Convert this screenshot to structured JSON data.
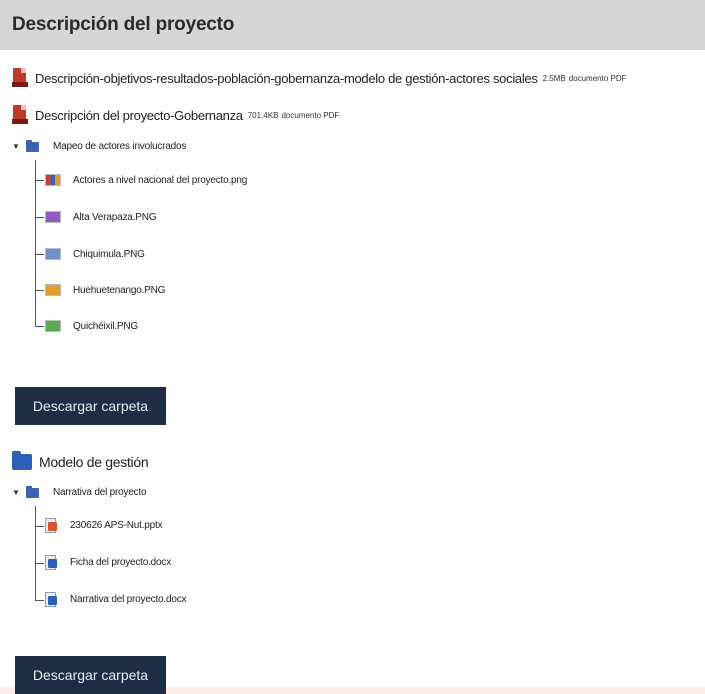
{
  "header": {
    "title": "Descripción del proyecto"
  },
  "files": [
    {
      "name": "Descripción-objetivos-resultados-población-gobernanza-modelo de gestión-actores sociales",
      "size": "2.5MB",
      "type": "documento PDF"
    },
    {
      "name": "Descripción del proyecto-Gobernanza",
      "size": "701.4KB",
      "type": "documento PDF"
    }
  ],
  "folder1": {
    "name": "Mapeo de actores involucrados",
    "items": [
      {
        "label": "Actores a nivel nacional del proyecto.png",
        "color": "#d23a3a"
      },
      {
        "label": "Alta Verapaza.PNG",
        "color": "#8e5cc0"
      },
      {
        "label": "Chiquimula.PNG",
        "color": "#6f8fc7"
      },
      {
        "label": "Huehuetenango.PNG",
        "color": "#e0a030"
      },
      {
        "label": "Quichéixil.PNG",
        "color": "#5aaa55"
      }
    ],
    "button": "Descargar carpeta"
  },
  "folder2": {
    "title": "Modelo de gestión",
    "name": "Narrativa del proyecto",
    "items": [
      {
        "label": "230626 APS-Nut.pptx",
        "color": "#d9562b"
      },
      {
        "label": "Ficha del proyecto.docx",
        "color": "#2f5fb3"
      },
      {
        "label": "Narrativa del proyecto.docx",
        "color": "#2f5fb3"
      }
    ],
    "button": "Descargar carpeta"
  }
}
